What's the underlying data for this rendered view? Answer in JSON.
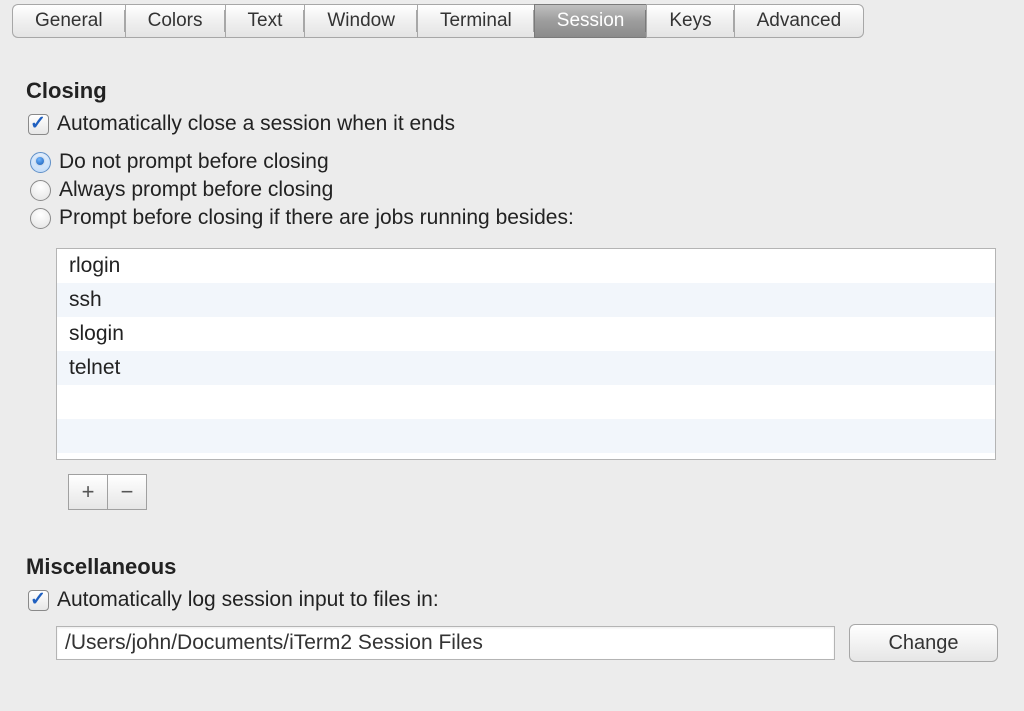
{
  "tabs": {
    "items": [
      {
        "label": "General"
      },
      {
        "label": "Colors"
      },
      {
        "label": "Text"
      },
      {
        "label": "Window"
      },
      {
        "label": "Terminal"
      },
      {
        "label": "Session"
      },
      {
        "label": "Keys"
      },
      {
        "label": "Advanced"
      }
    ],
    "active_index": 5
  },
  "closing": {
    "heading": "Closing",
    "auto_close_label": "Automatically close a session when it ends",
    "auto_close_checked": true,
    "prompt_options": [
      {
        "label": "Do not prompt before closing",
        "selected": true
      },
      {
        "label": "Always prompt before closing",
        "selected": false
      },
      {
        "label": "Prompt before closing if there are jobs running besides:",
        "selected": false
      }
    ],
    "jobs": [
      "rlogin",
      "ssh",
      "slogin",
      "telnet"
    ],
    "add_label": "+",
    "remove_label": "−"
  },
  "misc": {
    "heading": "Miscellaneous",
    "log_label": "Automatically log session input to files in:",
    "log_checked": true,
    "log_path": "/Users/john/Documents/iTerm2 Session Files",
    "change_label": "Change"
  }
}
